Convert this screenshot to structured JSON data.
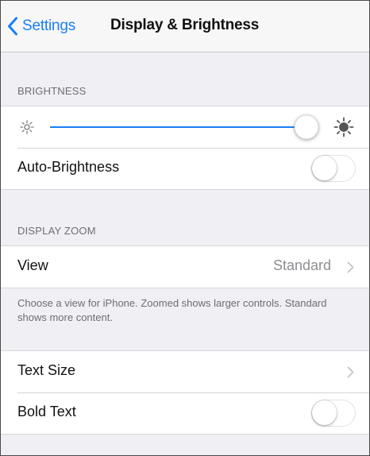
{
  "navbar": {
    "back_label": "Settings",
    "title": "Display & Brightness"
  },
  "brightness": {
    "header": "BRIGHTNESS",
    "level": 1.0,
    "auto_label": "Auto-Brightness",
    "auto_on": false
  },
  "display_zoom": {
    "header": "DISPLAY ZOOM",
    "view_label": "View",
    "view_value": "Standard",
    "footer": "Choose a view for iPhone. Zoomed shows larger controls. Standard shows more content."
  },
  "text": {
    "text_size_label": "Text Size",
    "bold_text_label": "Bold Text",
    "bold_on": false
  },
  "colors": {
    "accent": "#1a7ff6",
    "background": "#efeff4",
    "secondary_text": "#6d6d72",
    "value_text": "#8e8e93"
  },
  "icons": {
    "back": "chevron-left-icon",
    "brightness_low": "sun-small-icon",
    "brightness_high": "sun-large-icon",
    "disclosure": "chevron-right-icon"
  }
}
